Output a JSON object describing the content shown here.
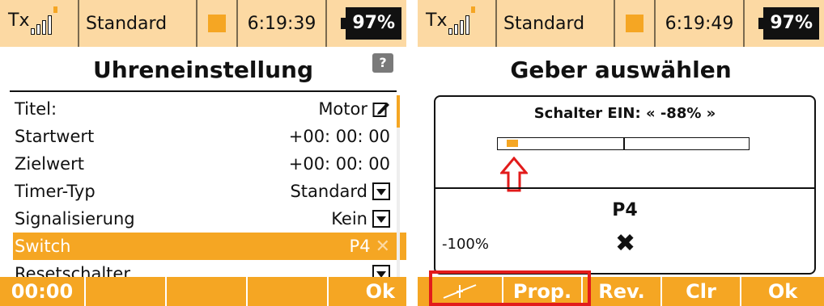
{
  "left": {
    "status": {
      "tx": "Tx",
      "model": "Standard",
      "time": "6:19:39",
      "battery": "97%"
    },
    "title": "Uhreneinstellung",
    "help_label": "?",
    "rows": [
      {
        "label": "Titel:",
        "value": "Motor"
      },
      {
        "label": "Startwert",
        "value": "+00: 00: 00"
      },
      {
        "label": "Zielwert",
        "value": "+00: 00: 00"
      },
      {
        "label": "Timer-Typ",
        "value": "Standard"
      },
      {
        "label": "Signalisierung",
        "value": "Kein"
      },
      {
        "label": "Switch",
        "value": "P4"
      },
      {
        "label": "Resetschalter",
        "value": ""
      }
    ],
    "softkeys": [
      "00:00",
      "",
      "",
      "",
      "Ok"
    ]
  },
  "right": {
    "status": {
      "tx": "Tx",
      "model": "Standard",
      "time": "6:19:49",
      "battery": "97%"
    },
    "title": "Geber auswählen",
    "switch_label": "Schalter EIN: « -88% »",
    "bar_value_percent": -88,
    "control_name": "P4",
    "percent": "-100%",
    "softkeys": [
      "",
      "Prop.",
      "Rev.",
      "Clr",
      "Ok"
    ]
  },
  "colors": {
    "accent": "#f5a623",
    "status_bg": "#fcd9a3",
    "highlight_red": "#e21b1b"
  }
}
